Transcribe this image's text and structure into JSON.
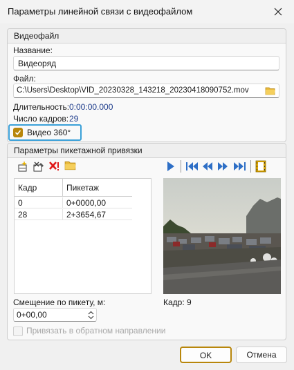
{
  "window": {
    "title": "Параметры линейной связи с видеофайлом"
  },
  "video_group": {
    "header": "Видеофайл",
    "name_label": "Название:",
    "name_value": "Видеоряд",
    "file_label": "Файл:",
    "file_value": "C:\\Users\\Desktop\\VID_20230328_143218_20230418090752.mov",
    "duration_label": "Длительность:",
    "duration_value": "0:00:00.000",
    "frames_label": "Число кадров:",
    "frames_value": "29",
    "video360_label": "Видео 360°",
    "video360_checked": true
  },
  "picket_group": {
    "header": "Параметры пикетажной привязки",
    "table": {
      "columns": [
        "Кадр",
        "Пикетаж"
      ],
      "rows": [
        [
          "0",
          "0+0000,00"
        ],
        [
          "28",
          "2+3654,67"
        ]
      ]
    },
    "frame_label": "Кадр: 9",
    "offset_label": "Смещение по пикету, м:",
    "offset_value": "0+00,00",
    "reverse_label": "Привязать в обратном направлении"
  },
  "buttons": {
    "ok": "OK",
    "cancel": "Отмена"
  },
  "colors": {
    "accent_gold": "#b8860b",
    "focus_blue": "#3aa0d8",
    "play_blue": "#2e6fc6",
    "value_blue": "#1b3a8a"
  }
}
